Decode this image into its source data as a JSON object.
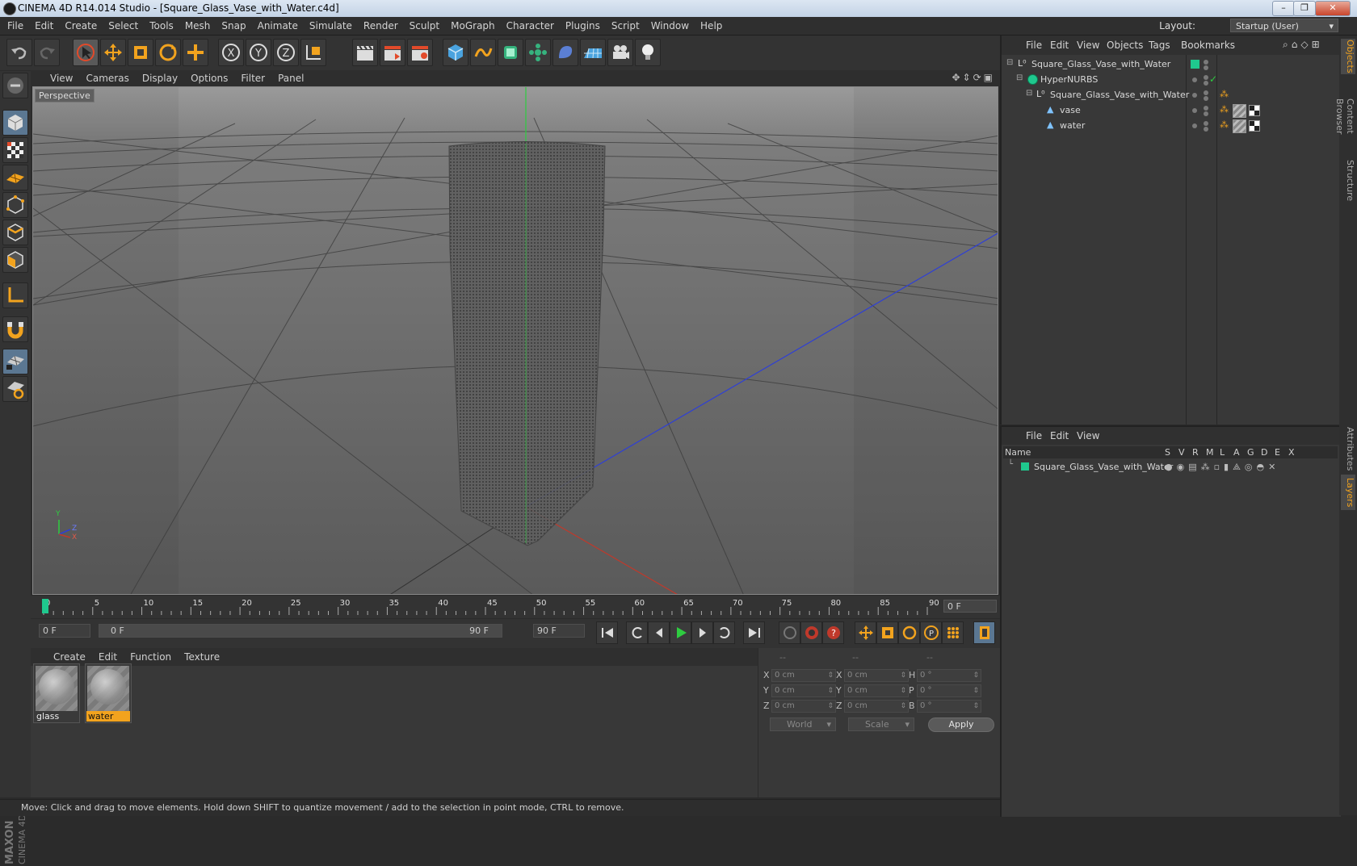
{
  "window": {
    "title": "CINEMA 4D R14.014 Studio - [Square_Glass_Vase_with_Water.c4d]",
    "min": "–",
    "max": "❐",
    "close": "✕"
  },
  "menu": [
    "File",
    "Edit",
    "Create",
    "Select",
    "Tools",
    "Mesh",
    "Snap",
    "Animate",
    "Simulate",
    "Render",
    "Sculpt",
    "MoGraph",
    "Character",
    "Plugins",
    "Script",
    "Window",
    "Help"
  ],
  "layout": {
    "label": "Layout:",
    "value": "Startup (User)"
  },
  "viewport": {
    "menu": [
      "View",
      "Cameras",
      "Display",
      "Options",
      "Filter",
      "Panel"
    ],
    "label": "Perspective",
    "axis": {
      "y": "Y",
      "z": "Z",
      "x": "X"
    }
  },
  "timeline": {
    "ticks": [
      "0",
      "5",
      "10",
      "15",
      "20",
      "25",
      "30",
      "35",
      "40",
      "45",
      "50",
      "55",
      "60",
      "65",
      "70",
      "75",
      "80",
      "85",
      "90"
    ],
    "current_frame": "0 F",
    "start_field": "0 F",
    "range_start": "0 F",
    "range_end": "90 F",
    "end_field": "90 F"
  },
  "materials": {
    "menu": [
      "Create",
      "Edit",
      "Function",
      "Texture"
    ],
    "items": [
      {
        "name": "glass"
      },
      {
        "name": "water"
      }
    ]
  },
  "coords": {
    "headers": [
      "--",
      "--",
      "--"
    ],
    "rows": [
      {
        "a": "X",
        "av": "0 cm",
        "b": "X",
        "bv": "0 cm",
        "c": "H",
        "cv": "0 °"
      },
      {
        "a": "Y",
        "av": "0 cm",
        "b": "Y",
        "bv": "0 cm",
        "c": "P",
        "cv": "0 °"
      },
      {
        "a": "Z",
        "av": "0 cm",
        "b": "Z",
        "bv": "0 cm",
        "c": "B",
        "cv": "0 °"
      }
    ],
    "world": "World",
    "scale": "Scale",
    "apply": "Apply"
  },
  "status": "Move: Click and drag to move elements. Hold down SHIFT to quantize movement / add to the selection in point mode, CTRL to remove.",
  "object_manager": {
    "menu": [
      "File",
      "Edit",
      "View",
      "Objects",
      "Tags",
      "Bookmarks"
    ],
    "objects": [
      {
        "name": "Square_Glass_Vase_with_Water"
      },
      {
        "name": "HyperNURBS"
      },
      {
        "name": "Square_Glass_Vase_with_Water"
      },
      {
        "name": "vase"
      },
      {
        "name": "water"
      }
    ]
  },
  "layer_manager": {
    "menu": [
      "File",
      "Edit",
      "View"
    ],
    "columns": [
      "Name",
      "S",
      "V",
      "R",
      "M",
      "L",
      "A",
      "G",
      "D",
      "E",
      "X"
    ],
    "layer": "Square_Glass_Vase_with_Water"
  },
  "right_tabs": [
    "Objects",
    "Content Browser",
    "Structure",
    "Attributes",
    "Layers"
  ],
  "branding": "MAXON CINEMA 4D",
  "colors": {
    "accent": "#f2a31e",
    "layer_green": "#1fc88e",
    "x_axis": "#c0392b",
    "y_axis": "#2ecc40",
    "z_axis": "#2e3fd6"
  }
}
